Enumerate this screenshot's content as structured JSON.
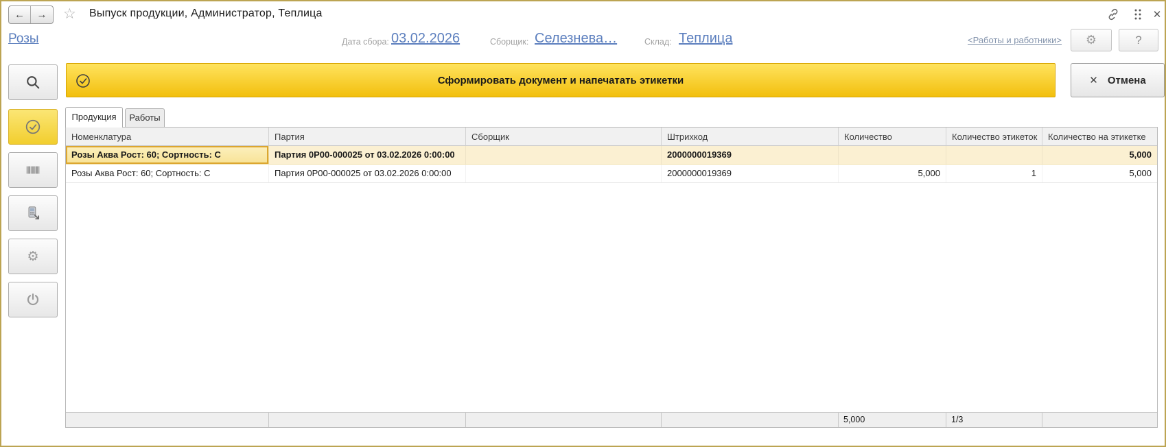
{
  "window": {
    "title": "Выпуск продукции, Администратор, Теплица"
  },
  "titlebar": {
    "back_icon": "←",
    "forward_icon": "→",
    "favorite_icon": "☆",
    "close_icon": "✕"
  },
  "header": {
    "breadcrumb": "Розы",
    "fields": [
      {
        "label": "Дата сбора:",
        "value": "03.02.2026"
      },
      {
        "label": "Сборщик:",
        "value": "Селезнева…"
      },
      {
        "label": "Склад:",
        "value": "Теплица"
      }
    ],
    "works_link": "<Работы и работники>",
    "settings_icon": "⚙",
    "help_label": "?"
  },
  "actions": {
    "generate_label": "Сформировать документ и напечатать этикетки",
    "cancel_label": "Отмена",
    "cancel_icon": "✕"
  },
  "sidebar": {
    "items": [
      {
        "name": "search"
      },
      {
        "name": "confirm",
        "active": true
      },
      {
        "name": "barcode"
      },
      {
        "name": "terminal"
      },
      {
        "name": "settings",
        "icon": "⚙"
      },
      {
        "name": "power"
      }
    ]
  },
  "tabs": [
    {
      "label": "Продукция",
      "active": true
    },
    {
      "label": "Работы",
      "active": false
    }
  ],
  "table": {
    "columns": [
      "Номенклатура",
      "Партия",
      "Сборщик",
      "Штрихкод",
      "Количество",
      "Количество этикеток",
      "Количество на этикетке"
    ],
    "rows": [
      {
        "nomenclature": "Розы Аква Рост: 60; Сортность: С",
        "batch": "Партия 0Р00-000025 от 03.02.2026 0:00:00",
        "collector": "",
        "barcode": "2000000019369",
        "quantity": "",
        "labels_count": "",
        "qty_per_label": "5,000"
      },
      {
        "nomenclature": "Розы Аква Рост: 60; Сортность: С",
        "batch": "Партия 0Р00-000025 от 03.02.2026 0:00:00",
        "collector": "",
        "barcode": "2000000019369",
        "quantity": "5,000",
        "labels_count": "1",
        "qty_per_label": "5,000"
      }
    ],
    "footer": {
      "quantity_total": "5,000",
      "labels_total": "1/3"
    }
  },
  "colors": {
    "accent_yellow": "#F2BF0D",
    "link_blue": "#5C7FBE",
    "barcode_red": "#B42025",
    "selected_row_bg": "#FBF0D2",
    "window_border": "#BCA452"
  }
}
